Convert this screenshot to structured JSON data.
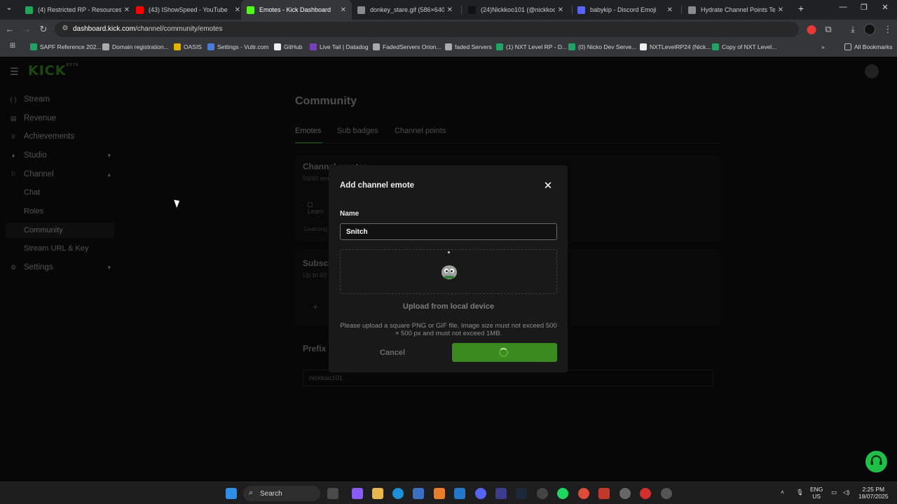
{
  "browser": {
    "tabs": [
      {
        "title": "(4) Restricted RP - Resources",
        "color": "#23a559"
      },
      {
        "title": "(43) IShowSpeed - YouTube",
        "color": "#ff0000"
      },
      {
        "title": "Emotes - Kick Dashboard",
        "color": "#53fc18"
      },
      {
        "title": "donkey_stare.gif (586×640)",
        "color": "#8a8a8a"
      },
      {
        "title": "(24)Nickkoo101 (@nickkoo101",
        "color": "#111111"
      },
      {
        "title": "babykip - Discord Emoji",
        "color": "#5865f2"
      },
      {
        "title": "Hydrate Channel Points Text",
        "color": "#8a8a8a"
      }
    ],
    "url_host": "dashboard.kick.com",
    "url_path": "/channel/community/emotes",
    "bookmarks": [
      {
        "label": "SAPF Reference 202...",
        "color": "#1fa463"
      },
      {
        "label": "Domain registration...",
        "color": "#aaaaaa"
      },
      {
        "label": "OASIS",
        "color": "#e0b400"
      },
      {
        "label": "Settings - Vultr.com",
        "color": "#4a7bd6"
      },
      {
        "label": "GitHub",
        "color": "#eeeeee"
      },
      {
        "label": "Live Tail | Datadog",
        "color": "#7a3fbf"
      },
      {
        "label": "FadedServers Orion...",
        "color": "#aaaaaa"
      },
      {
        "label": "faded Servers",
        "color": "#aaaaaa"
      },
      {
        "label": "(1) NXT Level RP - D...",
        "color": "#1fa463"
      },
      {
        "label": "(0) Nicko Dev Serve...",
        "color": "#1fa463"
      },
      {
        "label": "NXTLevelRP24 (Nick...",
        "color": "#eeeeee"
      },
      {
        "label": "Copy of NXT Level...",
        "color": "#1fa463"
      }
    ],
    "all_bookmarks": "All Bookmarks"
  },
  "sidebar": {
    "logo": "KICK",
    "logo_badge": "BETA",
    "items": [
      {
        "label": "Stream",
        "icon": "radio-icon"
      },
      {
        "label": "Revenue",
        "icon": "wallet-icon"
      },
      {
        "label": "Achievements",
        "icon": "trophy-icon"
      },
      {
        "label": "Studio",
        "icon": "studio-icon"
      },
      {
        "label": "Channel",
        "icon": "channel-icon"
      }
    ],
    "channel_sub": [
      "Chat",
      "Roles",
      "Community",
      "Stream URL & Key"
    ],
    "settings": "Settings"
  },
  "main": {
    "title": "Community",
    "tabs": [
      "Emotes",
      "Sub badges",
      "Channel points"
    ],
    "card1_title": "Channel emotes",
    "card1_sub": "59/60 emotes",
    "learning_label": "Learning",
    "learn_img_alt": "Learn",
    "card2_title": "Subscriber emotes",
    "card2_sub": "Up to 60",
    "add_symbol": "+",
    "prefix_title": "Prefix",
    "prefix_value": "nickkoo101"
  },
  "modal": {
    "title": "Add channel emote",
    "name_label": "Name",
    "name_value": "Snitch",
    "upload_label": "Upload from local device",
    "hint": "Please upload a square PNG or GIF file. Image size must not exceed 500 × 500 px and must not exceed 1MB.",
    "cancel": "Cancel"
  },
  "taskbar": {
    "search": "Search",
    "lang_1": "ENG",
    "lang_2": "US",
    "time": "2:25 PM",
    "date": "18/07/2025"
  }
}
